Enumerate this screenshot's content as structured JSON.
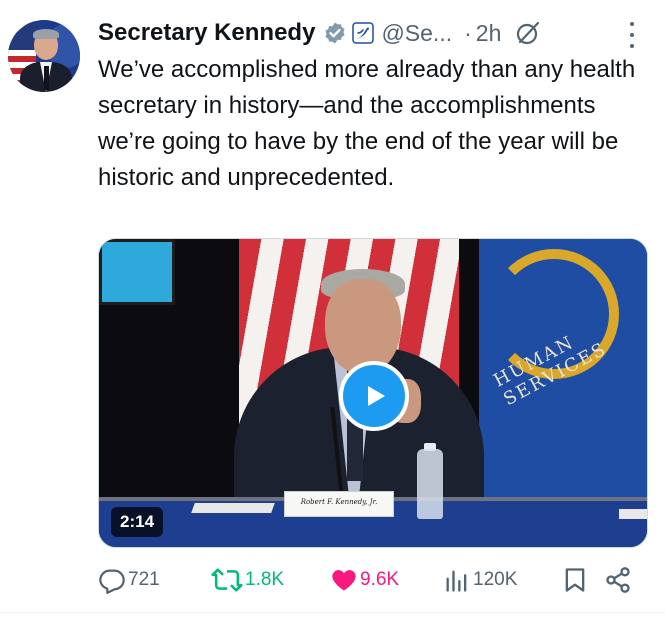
{
  "tweet": {
    "display_name": "Secretary Kennedy",
    "handle": "@Se...",
    "separator": "·",
    "time": "2h",
    "text": "We’ve accomplished more already than any health secretary in history—and the accomplishments we’re going to have by the end of the year will be historic and unprecedented.",
    "icons": {
      "verified": "verified-badge-icon",
      "affiliation": "hhs-affiliation-badge-icon",
      "grok": "grok-icon",
      "more": "more-options-icon"
    }
  },
  "media": {
    "duration": "2:14",
    "nameplate": "Robert F. Kennedy, Jr.",
    "banner_text": "HUMAN SERVICES",
    "play_icon": "play-icon"
  },
  "actions": {
    "replies": "721",
    "reposts": "1.8K",
    "likes": "9.6K",
    "views": "120K",
    "liked": true,
    "colors": {
      "muted": "#536471",
      "repost": "#00ba7c",
      "like": "#f91880",
      "accent": "#1d9bf0"
    }
  }
}
